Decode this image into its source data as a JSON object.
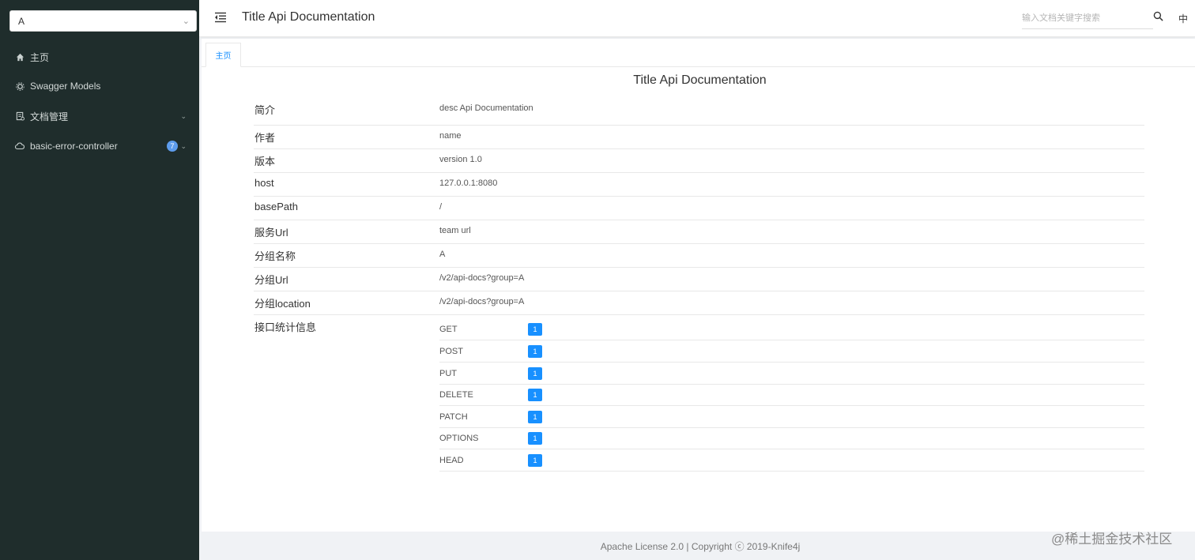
{
  "sidebar": {
    "group_select": {
      "value": "A"
    },
    "items": [
      {
        "label": "主页",
        "icon": "home-icon"
      },
      {
        "label": "Swagger Models",
        "icon": "models-icon"
      },
      {
        "label": "文档管理",
        "icon": "docs-icon"
      },
      {
        "label": "basic-error-controller",
        "icon": "cloud-icon",
        "badge": "7"
      }
    ]
  },
  "header": {
    "title": "Title Api Documentation",
    "search_placeholder": "输入文档关键字搜索",
    "lang": "中"
  },
  "tabs": [
    {
      "label": "主页"
    }
  ],
  "main": {
    "title": "Title Api Documentation",
    "info": [
      {
        "label": "简介",
        "value": "desc Api Documentation"
      },
      {
        "label": "作者",
        "value": "name"
      },
      {
        "label": "版本",
        "value": "version 1.0"
      },
      {
        "label": "host",
        "value": "127.0.0.1:8080"
      },
      {
        "label": "basePath",
        "value": "/"
      },
      {
        "label": "服务Url",
        "value": "team url"
      },
      {
        "label": "分组名称",
        "value": "A"
      },
      {
        "label": "分组Url",
        "value": "/v2/api-docs?group=A"
      },
      {
        "label": "分组location",
        "value": "/v2/api-docs?group=A"
      }
    ],
    "stats_label": "接口统计信息",
    "stats": [
      {
        "method": "GET",
        "count": "1"
      },
      {
        "method": "POST",
        "count": "1"
      },
      {
        "method": "PUT",
        "count": "1"
      },
      {
        "method": "DELETE",
        "count": "1"
      },
      {
        "method": "PATCH",
        "count": "1"
      },
      {
        "method": "OPTIONS",
        "count": "1"
      },
      {
        "method": "HEAD",
        "count": "1"
      }
    ]
  },
  "footer": {
    "text": "Apache License 2.0 | Copyright ⓒ 2019-Knife4j",
    "watermark": "@稀土掘金技术社区"
  },
  "colors": {
    "sidebar_bg": "#1f2d2c",
    "accent": "#1890ff",
    "badge": "#5d9cec"
  }
}
